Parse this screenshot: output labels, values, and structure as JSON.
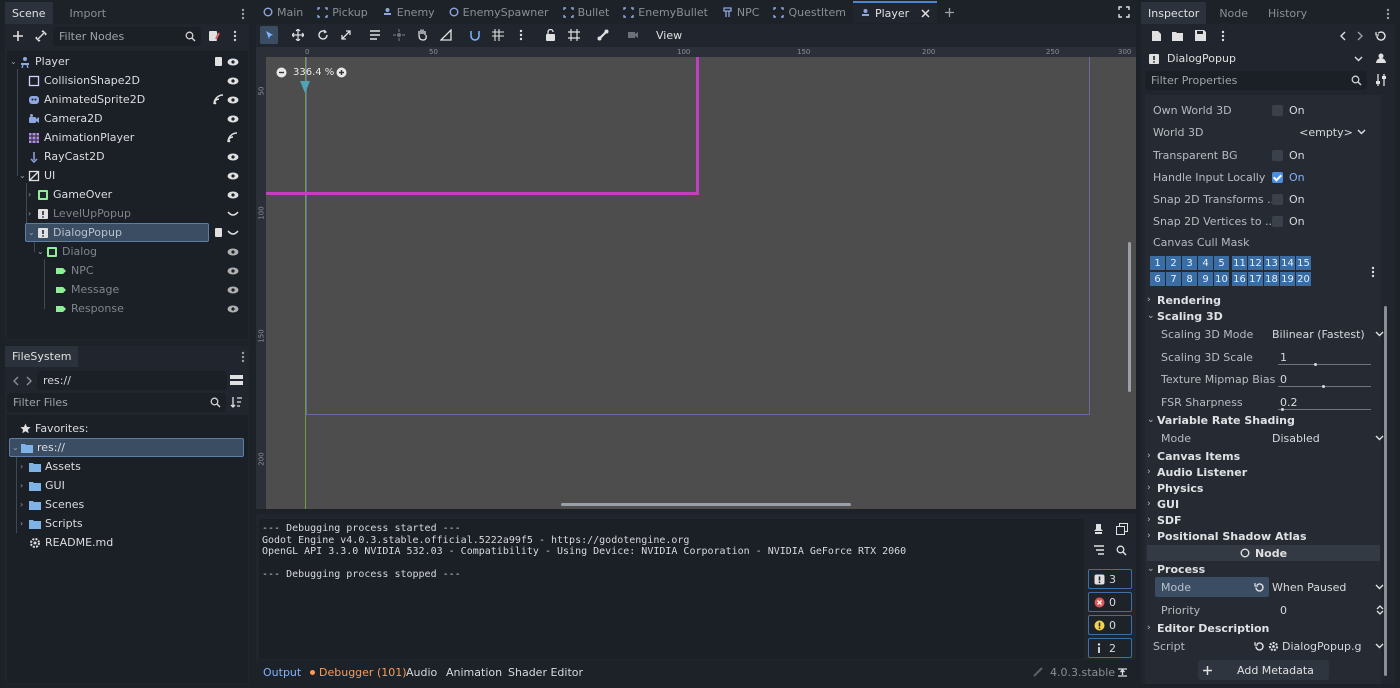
{
  "scene_dock": {
    "tabs": [
      "Scene",
      "Import"
    ],
    "filter_placeholder": "Filter Nodes",
    "nodes": [
      {
        "label": "Player"
      },
      {
        "label": "CollisionShape2D"
      },
      {
        "label": "AnimatedSprite2D"
      },
      {
        "label": "Camera2D"
      },
      {
        "label": "AnimationPlayer"
      },
      {
        "label": "RayCast2D"
      },
      {
        "label": "UI"
      },
      {
        "label": "GameOver"
      },
      {
        "label": "LevelUpPopup"
      },
      {
        "label": "DialogPopup"
      },
      {
        "label": "Dialog"
      },
      {
        "label": "NPC"
      },
      {
        "label": "Message"
      },
      {
        "label": "Response"
      }
    ]
  },
  "filesystem": {
    "tab": "FileSystem",
    "path": "res://",
    "filter_placeholder": "Filter Files",
    "favorites": "Favorites:",
    "items": [
      {
        "label": "res://"
      },
      {
        "label": "Assets"
      },
      {
        "label": "GUI"
      },
      {
        "label": "Scenes"
      },
      {
        "label": "Scripts"
      },
      {
        "label": "README.md"
      }
    ]
  },
  "scene_tabs": [
    "Main",
    "Pickup",
    "Enemy",
    "EnemySpawner",
    "Bullet",
    "EnemyBullet",
    "NPC",
    "QuestItem",
    "Player"
  ],
  "viewport": {
    "view_menu": "View",
    "zoom": "336.4 %",
    "ruler_h": [
      "0",
      "50",
      "100",
      "150",
      "200",
      "250",
      "300"
    ],
    "ruler_v": [
      "50",
      "100",
      "150",
      "200"
    ],
    "accent_pink": "#c040c0"
  },
  "console": {
    "lines": [
      "--- Debugging process started ---",
      "Godot Engine v4.0.3.stable.official.5222a99f5 - https://godotengine.org",
      "OpenGL API 3.3.0 NVIDIA 532.03 - Compatibility - Using Device: NVIDIA Corporation - NVIDIA GeForce RTX 2060",
      "",
      "--- Debugging process stopped ---"
    ],
    "counts": {
      "messages": "3",
      "errors": "0",
      "warnings": "0",
      "info": "2"
    }
  },
  "bottom_tabs": {
    "output": "Output",
    "debugger": "Debugger (101)",
    "audio": "Audio",
    "animation": "Animation",
    "shader_editor": "Shader Editor",
    "version": "4.0.3.stable"
  },
  "inspector": {
    "tabs": [
      "Inspector",
      "Node",
      "History"
    ],
    "object": "DialogPopup",
    "filter_placeholder": "Filter Properties",
    "props_top": [
      {
        "label": "Own World 3D",
        "value": "On",
        "checked": false
      },
      {
        "label": "World 3D",
        "value": "<empty>"
      },
      {
        "label": "Transparent BG",
        "value": "On",
        "checked": false
      },
      {
        "label": "Handle Input Locally",
        "value": "On",
        "checked": true
      },
      {
        "label": "Snap 2D Transforms ...",
        "value": "On",
        "checked": false
      },
      {
        "label": "Snap 2D Vertices to ...",
        "value": "On",
        "checked": false
      }
    ],
    "canvas_cull_mask": "Canvas Cull Mask",
    "mask_row1": [
      "1",
      "2",
      "3",
      "4",
      "5",
      "11",
      "12",
      "13",
      "14",
      "15"
    ],
    "mask_row2": [
      "6",
      "7",
      "8",
      "9",
      "10",
      "16",
      "17",
      "18",
      "19",
      "20"
    ],
    "rendering": "Rendering",
    "scaling_3d": "Scaling 3D",
    "scaling_props": [
      {
        "label": "Scaling 3D Mode",
        "value": "Bilinear (Fastest)"
      },
      {
        "label": "Scaling 3D Scale",
        "value": "1"
      },
      {
        "label": "Texture Mipmap Bias",
        "value": "0"
      },
      {
        "label": "FSR Sharpness",
        "value": "0.2"
      }
    ],
    "vrs": "Variable Rate Shading",
    "vrs_mode_label": "Mode",
    "vrs_mode_value": "Disabled",
    "sections": [
      "Canvas Items",
      "Audio Listener",
      "Physics",
      "GUI",
      "SDF",
      "Positional Shadow Atlas"
    ],
    "node_header": "Node",
    "process": "Process",
    "process_mode_label": "Mode",
    "process_mode_value": "When Paused",
    "priority_label": "Priority",
    "priority_value": "0",
    "editor_description": "Editor Description",
    "script_label": "Script",
    "script_value": "DialogPopup.g",
    "add_metadata": "Add Metadata"
  }
}
